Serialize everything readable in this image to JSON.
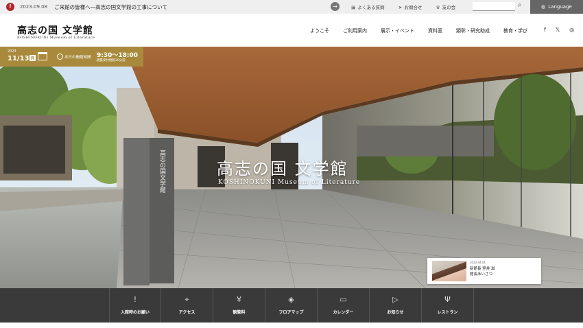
{
  "notice": {
    "icon": "info-icon",
    "date": "2023.09.08",
    "text": "ご来館の皆様へ―高志の国文学館の工事について"
  },
  "utility": {
    "faq": "よくある質問",
    "contact": "お問合せ",
    "friends": "友の会",
    "language": "Language"
  },
  "logo": {
    "jp": "高志の国 文学館",
    "en": "KOSHINOKUNI Museum of Literature"
  },
  "nav": [
    "ようこそ",
    "ご利用案内",
    "展示・イベント",
    "資料室",
    "顕彰・研究助成",
    "教育・学び"
  ],
  "social": [
    "f",
    "𝕏",
    "◎"
  ],
  "hours": {
    "year": "2023",
    "date": "11/13",
    "day": "月",
    "label": "本日の開館時間",
    "time": "9:30〜18:00",
    "note": "観覧受付閉館30分前"
  },
  "hero": {
    "title": "高志の国 文学館",
    "subtitle": "KOSHINOKUNI Museum of Literature",
    "sign_title": "高志の国文学館"
  },
  "director": {
    "date": "2023.04.01",
    "line1": "新館長 室井 滋",
    "line2": "館長あいさつ"
  },
  "bottom_nav": [
    {
      "label": "入館時のお願い",
      "icon": "alert-circle-icon",
      "glyph": "!"
    },
    {
      "label": "アクセス",
      "icon": "map-pin-icon",
      "glyph": "⌖"
    },
    {
      "label": "観覧料",
      "icon": "yen-icon",
      "glyph": "¥"
    },
    {
      "label": "フロアマップ",
      "icon": "layers-icon",
      "glyph": "◈"
    },
    {
      "label": "カレンダー",
      "icon": "calendar-icon",
      "glyph": "▭"
    },
    {
      "label": "お知らせ",
      "icon": "flag-icon",
      "glyph": "▷"
    },
    {
      "label": "レストラン",
      "icon": "restaurant-icon",
      "glyph": "Ψ"
    }
  ],
  "colors": {
    "hours_bg": "#a98a3c",
    "bottom_nav_bg": "#3a3a3a",
    "notice_icon": "#b3262d",
    "language_bg": "#666666"
  }
}
